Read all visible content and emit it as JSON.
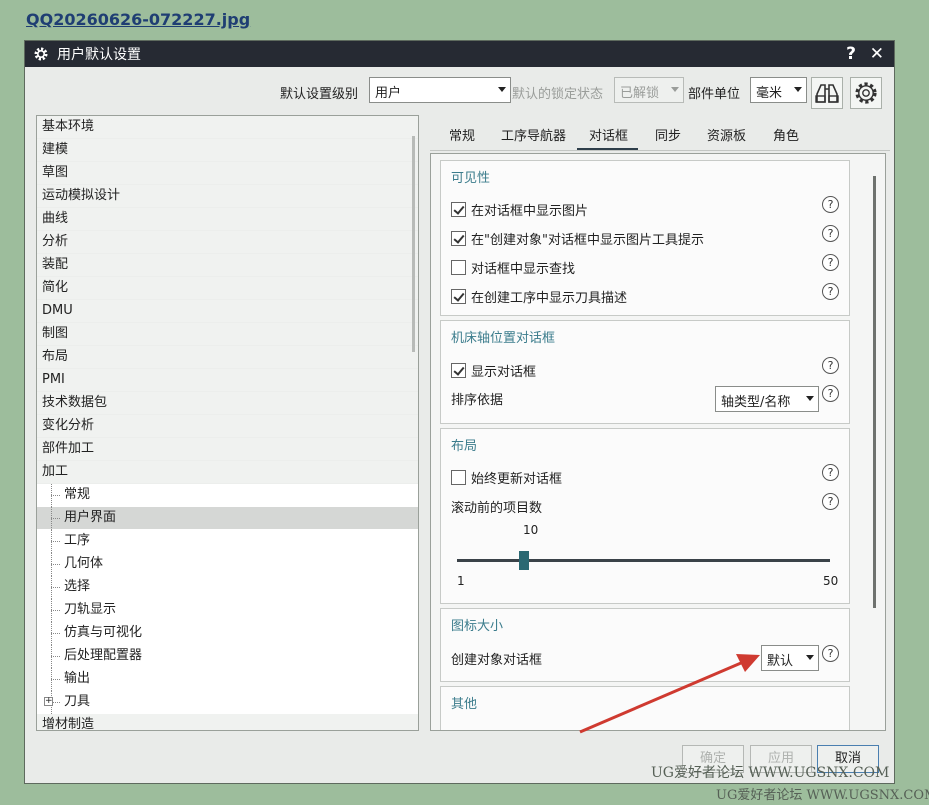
{
  "filename": "QQ20260626-072227.jpg",
  "dialog": {
    "title": "用户默认设置",
    "help": "?",
    "close": "✕"
  },
  "toolbar": {
    "level_label": "默认设置级别",
    "level_value": "用户",
    "lock_label": "默认的锁定状态",
    "lock_value": "已解锁",
    "unit_label": "部件单位",
    "unit_value": "毫米"
  },
  "tree": {
    "items": [
      "基本环境",
      "建模",
      "草图",
      "运动模拟设计",
      "曲线",
      "分析",
      "装配",
      "简化",
      "DMU",
      "制图",
      "布局",
      "PMI",
      "技术数据包",
      "变化分析",
      "部件加工",
      "加工"
    ],
    "children": [
      "常规",
      "用户界面",
      "工序",
      "几何体",
      "选择",
      "刀轨显示",
      "仿真与可视化",
      "后处理配置器",
      "输出",
      "刀具"
    ],
    "tail": "增材制造",
    "expander": "+"
  },
  "tabs": [
    "常规",
    "工序导航器",
    "对话框",
    "同步",
    "资源板",
    "角色"
  ],
  "visibility": {
    "title": "可见性",
    "opt1": "在对话框中显示图片",
    "opt2": "在\"创建对象\"对话框中显示图片工具提示",
    "opt3": "对话框中显示查找",
    "opt4": "在创建工序中显示刀具描述"
  },
  "axis": {
    "title": "机床轴位置对话框",
    "show": "显示对话框",
    "sort_label": "排序依据",
    "sort_value": "轴类型/名称"
  },
  "layout": {
    "title": "布局",
    "always_update": "始终更新对话框",
    "scroll_label": "滚动前的项目数",
    "slider_value": "10",
    "slider_min": "1",
    "slider_max": "50",
    "slider_fraction": 0.18
  },
  "iconsize": {
    "title": "图标大小",
    "label": "创建对象对话框",
    "value": "默认"
  },
  "other": {
    "title": "其他"
  },
  "buttons": {
    "ok": "确定",
    "apply": "应用",
    "cancel": "取消"
  },
  "help_mark": "?",
  "watermarks": {
    "w1": "UG爱好者论坛 WWW.UGSNX.COM",
    "w2": "UG爱好者论坛 WWW.UGSNX.COM"
  }
}
